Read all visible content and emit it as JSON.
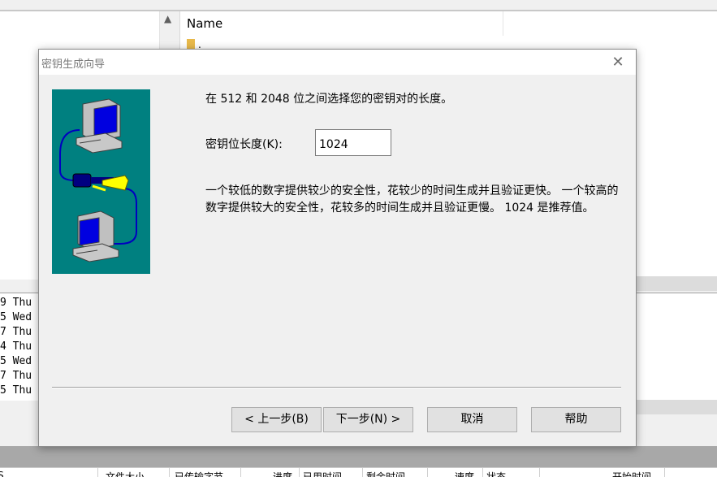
{
  "background": {
    "file_list": {
      "column_header": "Name",
      "first_item": "."
    },
    "log_lines": [
      "9 Thu",
      "5 Wed",
      "7 Thu",
      "4 Thu",
      "5 Wed",
      "7 Thu",
      "5 Thu"
    ],
    "status_cells": [
      "S",
      "文件大小",
      "已传输字节",
      "进度",
      "已用时间",
      "剩余时间",
      "速度",
      "状态",
      "开始时间"
    ]
  },
  "dialog": {
    "title": "密钥生成向导",
    "close_glyph": "✕",
    "intro": "在 512 和 2048 位之间选择您的密钥对的长度。",
    "keylen_label": "密钥位长度(K):",
    "keylen_value": "1024",
    "description": "一个较低的数字提供较少的安全性，花较少的时间生成并且验证更快。 一个较高的数字提供较大的安全性，花较多的时间生成并且验证更慢。 1024 是推荐值。",
    "buttons": {
      "back": "< 上一步(B)",
      "next": "下一步(N) >",
      "cancel": "取消",
      "help": "帮助"
    }
  },
  "colors": {
    "wizard_bg": "#008080",
    "key_yellow": "#ffff00",
    "cable_blue": "#0000c0"
  },
  "icons": [
    "computer-icon",
    "key-icon"
  ]
}
